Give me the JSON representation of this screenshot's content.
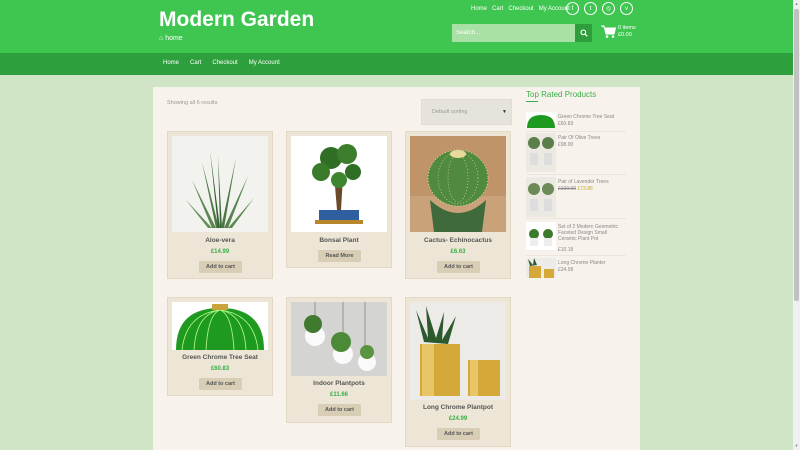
{
  "site": {
    "title": "Modern Garden",
    "tagline": "home"
  },
  "top_links": [
    "Home",
    "Cart",
    "Checkout",
    "My Account"
  ],
  "social_icons": [
    "facebook-icon",
    "twitter-icon",
    "instagram-icon",
    "vimeo-icon"
  ],
  "search": {
    "placeholder": "Search..."
  },
  "cart": {
    "items": "0 items",
    "total": "£0.00"
  },
  "nav": [
    "Home",
    "Cart",
    "Checkout",
    "My Account"
  ],
  "shop": {
    "showing": "Showing all 6 results",
    "sort_label": "Default sorting",
    "products": [
      {
        "name": "Aloe-vera",
        "price": "£14.99",
        "button": "Add to cart"
      },
      {
        "name": "Bonsai Plant",
        "price": "",
        "button": "Read More"
      },
      {
        "name": "Cactus- Echinocactus",
        "price": "£6.63",
        "button": "Add to cart"
      },
      {
        "name": "Green Chrome Tree Seat",
        "price": "£60.83",
        "button": "Add to cart"
      },
      {
        "name": "Indoor Plantpots",
        "price": "£11.66",
        "button": "Add to cart"
      },
      {
        "name": "Long Chrome Plantpot",
        "price": "£24.99",
        "button": "Add to cart"
      }
    ]
  },
  "sidebar": {
    "title": "Top Rated Products",
    "items": [
      {
        "name": "Green Chrome Tree Seat",
        "price": "£60.83"
      },
      {
        "name": "Pair Of Olive Trees",
        "price": "£98.00"
      },
      {
        "name": "Pair of Lavender Trees",
        "old_price": "£100.00",
        "price": "£73.86"
      },
      {
        "name": "Set of 2 Modern Geometric Faceted Design Small Ceramic Plant Pot",
        "price": "£10.18"
      },
      {
        "name": "Long Chrome Planter",
        "price": "£24.99"
      }
    ]
  },
  "colors": {
    "header": "#3fc650",
    "nav": "#2e9f3d",
    "accent": "#3aae48",
    "background": "#cfe5c6"
  }
}
